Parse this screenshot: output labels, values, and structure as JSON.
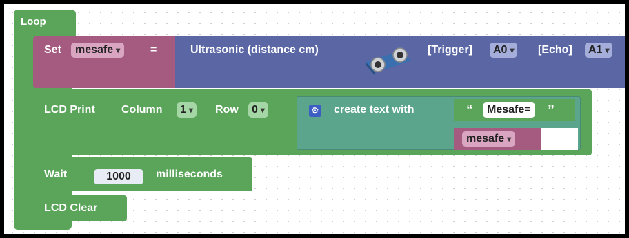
{
  "loop": {
    "label": "Loop"
  },
  "set_block": {
    "label": "Set",
    "variable": "mesafe",
    "equals": "="
  },
  "ultrasonic": {
    "label": "Ultrasonic (distance cm)",
    "trigger_label": "[Trigger]",
    "trigger_value": "A0",
    "echo_label": "[Echo]",
    "echo_value": "A1"
  },
  "lcd_print": {
    "label": "LCD Print",
    "column_label": "Column",
    "column_value": "1",
    "row_label": "Row",
    "row_value": "0"
  },
  "create_text": {
    "label": "create text with",
    "text_value": "Mesafe=",
    "quote_open": "“",
    "quote_close": "”",
    "variable": "mesafe"
  },
  "wait": {
    "label": "Wait",
    "value": "1000",
    "unit": "milliseconds"
  },
  "lcd_clear": {
    "label": "LCD Clear"
  },
  "colors": {
    "loop": "#5ba55b",
    "set": "#a55b80",
    "sensor": "#5b67a5",
    "lcd": "#5ba55b",
    "text": "#5ba58c"
  }
}
